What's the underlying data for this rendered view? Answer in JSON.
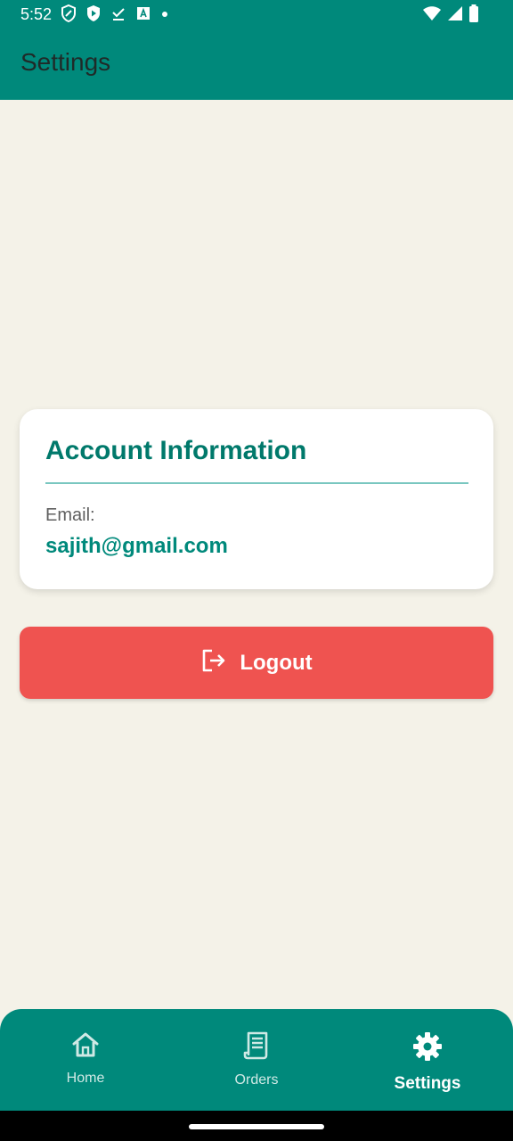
{
  "status_bar": {
    "time": "5:52",
    "left_icons": [
      "shield-outline-icon",
      "shield-play-icon",
      "download-done-icon",
      "translate-icon",
      "dot-icon"
    ],
    "right_icons": [
      "wifi-icon",
      "signal-icon",
      "battery-icon"
    ]
  },
  "app_bar": {
    "title": "Settings"
  },
  "account_card": {
    "title": "Account Information",
    "email_label": "Email:",
    "email_value": "sajith@gmail.com"
  },
  "logout": {
    "label": "Logout",
    "icon": "logout-icon"
  },
  "bottom_nav": {
    "items": [
      {
        "label": "Home",
        "icon": "home-icon",
        "active": false
      },
      {
        "label": "Orders",
        "icon": "receipt-icon",
        "active": false
      },
      {
        "label": "Settings",
        "icon": "gear-icon",
        "active": true
      }
    ]
  },
  "colors": {
    "primary": "#00897b",
    "primary_dark": "#00796b",
    "background": "#f4f2e8",
    "logout": "#ef5350"
  }
}
